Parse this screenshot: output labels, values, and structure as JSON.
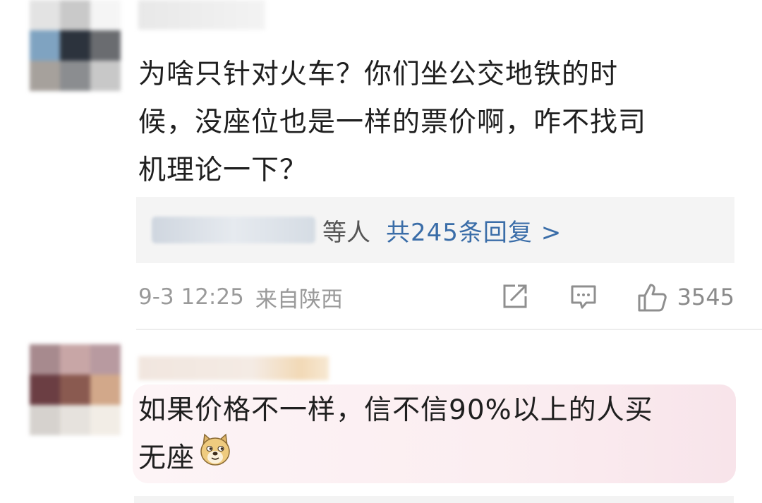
{
  "comments": [
    {
      "text": "为啥只针对火车？你们坐公交地铁的时\n候，没座位也是一样的票价啊，咋不找司\n机理论一下？",
      "replies": {
        "suffix": "等人",
        "count_label": "共245条回复 >"
      },
      "timestamp": "9-3 12:25",
      "location": "来自陕西",
      "likes": "3545",
      "icons": [
        "share-icon",
        "comment-icon",
        "like-icon"
      ]
    },
    {
      "text": "如果价格不一样，信不信90%以上的人买\n无座",
      "emoji": "doge-emoji-icon"
    }
  ],
  "colors": {
    "link_blue": "#3a6da8",
    "meta_gray": "#9a9a9a",
    "reply_box_bg": "#f4f4f4",
    "highlight_pink": "#fbeef1"
  }
}
